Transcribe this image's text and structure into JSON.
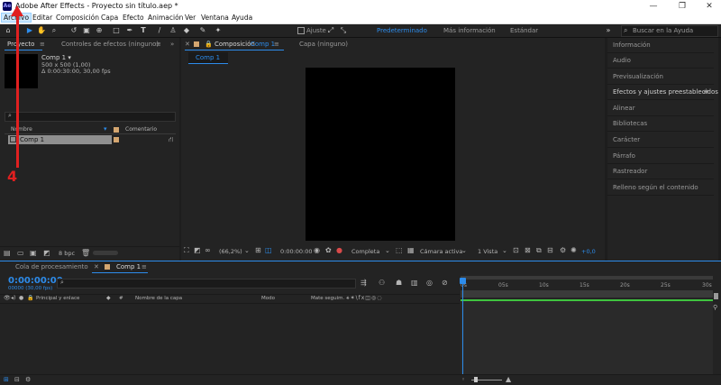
{
  "window": {
    "title": "Adobe After Effects - Proyecto sin título.aep *",
    "app_icon": "Ae",
    "minimize": "—",
    "restore": "❐",
    "close": "✕"
  },
  "menu": [
    "Archivo",
    "Editar",
    "Composición",
    "Capa",
    "Efecto",
    "Animación",
    "Ver",
    "Ventana",
    "Ayuda"
  ],
  "toolbar": {
    "snap_label": "Ajuste",
    "workspaces": [
      "Predeterminado",
      "Más información",
      "Estándar"
    ],
    "search_placeholder": "Buscar en la Ayuda"
  },
  "project_panel": {
    "tab_project": "Proyecto",
    "tab_effects": "Controles de efectos (ninguno)",
    "item_name": "Comp 1 ▾",
    "item_size": "500 x 500 (1,00)",
    "item_duration": "Δ 0:00:30:00, 30,00 fps",
    "col_name": "Nombre",
    "col_comment": "Comentario",
    "row_name": "Comp 1",
    "bpc": "8 bpc"
  },
  "comp_panel": {
    "tab_prefix": "Composición",
    "tab_comp": "Comp 1",
    "tab_layer": "Capa (ninguno)",
    "sub_tab": "Comp 1",
    "zoom": "(66,2%)",
    "timecode": "0:00:00:00",
    "resolution": "Completa",
    "camera": "Cámara activa",
    "views": "1 Vista",
    "exposure": "+0,0"
  },
  "right_panel": {
    "items": [
      "Información",
      "Audio",
      "Previsualización",
      "Efectos y ajustes preestablecidos",
      "Alinear",
      "Bibliotecas",
      "Carácter",
      "Párrafo",
      "Rastreador",
      "Relleno según el contenido"
    ]
  },
  "timeline": {
    "tab_queue": "Cola de procesamiento",
    "tab_comp": "Comp 1",
    "timecode": "0:00:00:00",
    "frames": "00000 (30,00 fps)",
    "col_parent": "Principal y enlace",
    "col_hash": "#",
    "col_layer": "Nombre de la capa",
    "col_mode": "Modo",
    "col_matte": "Mate seguim.",
    "ruler": [
      "0s",
      "05s",
      "10s",
      "15s",
      "20s",
      "25s",
      "30s"
    ]
  },
  "annotation": {
    "number": "4",
    "color": "#e02020"
  },
  "colors": {
    "accent": "#2d8ceb",
    "panel": "#232323",
    "background": "#1d1d1d",
    "comp_label": "#d4a670",
    "green_bar": "#3fc43f"
  }
}
